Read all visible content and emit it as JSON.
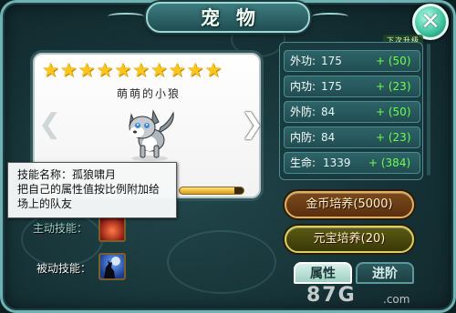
{
  "window": {
    "title": "宠物",
    "next_level_tag": "下次升级"
  },
  "pet": {
    "name": "萌萌的小狼",
    "stars": [
      "★",
      "★",
      "★",
      "★",
      "★",
      "★",
      "★",
      "★",
      "★",
      "★"
    ],
    "xp_fraction": 0.85
  },
  "tooltip": {
    "line1": "技能名称：孤狼啸月",
    "line2": "把自己的属性值按比例附加给",
    "line3": "场上的队友"
  },
  "skills": {
    "active_label": "主动技能：",
    "passive_label": "被动技能："
  },
  "stats": [
    {
      "name": "外功:",
      "value": "175",
      "increase": "+ (50)"
    },
    {
      "name": "内功:",
      "value": "175",
      "increase": "+ (23)"
    },
    {
      "name": "外防:",
      "value": "84",
      "increase": "+ (50)"
    },
    {
      "name": "内防:",
      "value": "84",
      "increase": "+ (23)"
    },
    {
      "name": "生命:",
      "value": "1339",
      "increase": "+ (384)"
    }
  ],
  "buttons": {
    "gold_cultivate": "金币培养(5000)",
    "yuanbao_cultivate": "元宝培养(20)"
  },
  "tabs": {
    "attributes": "属性",
    "advance": "进阶"
  },
  "watermark": {
    "main": "87G",
    "sub": ".com"
  },
  "icons": {
    "close": "close-icon",
    "left_arrow": "chevron-left-icon",
    "right_arrow": "chevron-right-icon",
    "active_skill": "fire-skill-icon",
    "passive_skill": "howling-wolf-icon"
  },
  "colors": {
    "star": "#ffc61a",
    "stat_increase": "#6cff4a",
    "panel_teal": "#214d52"
  }
}
